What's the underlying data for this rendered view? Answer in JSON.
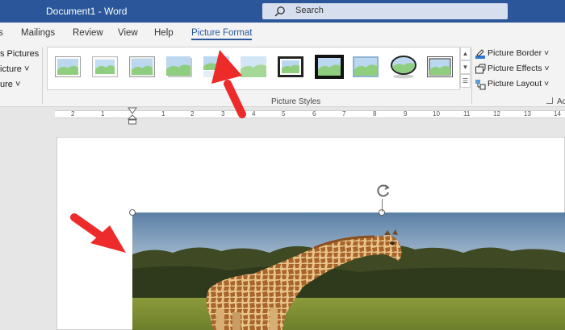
{
  "window": {
    "title": "Document1  -  Word"
  },
  "search": {
    "label": "Search"
  },
  "tabs": [
    {
      "label": "s"
    },
    {
      "label": "Mailings"
    },
    {
      "label": "Review"
    },
    {
      "label": "View"
    },
    {
      "label": "Help"
    },
    {
      "label": "Picture Format"
    }
  ],
  "ribbon": {
    "left_commands": [
      {
        "label": "s Pictures"
      },
      {
        "label": "icture ˅"
      },
      {
        "label": "ure ˅"
      }
    ],
    "group_label": "Picture Styles",
    "right_commands": [
      {
        "label": "Picture Border ˅",
        "icon": "picture-border-icon"
      },
      {
        "label": "Picture Effects ˅",
        "icon": "picture-effects-icon"
      },
      {
        "label": "Picture Layout ˅",
        "icon": "picture-layout-icon"
      }
    ],
    "cut_label": "Ac"
  },
  "ruler": {
    "numbers": [
      "2",
      "1",
      "1",
      "2",
      "3",
      "4",
      "5",
      "6",
      "7",
      "8",
      "9",
      "10",
      "11",
      "12",
      "13",
      "14"
    ]
  },
  "colors": {
    "titlebar": "#2b579a",
    "accent": "#2b579a",
    "annotation_arrow": "#ee2b2b"
  }
}
